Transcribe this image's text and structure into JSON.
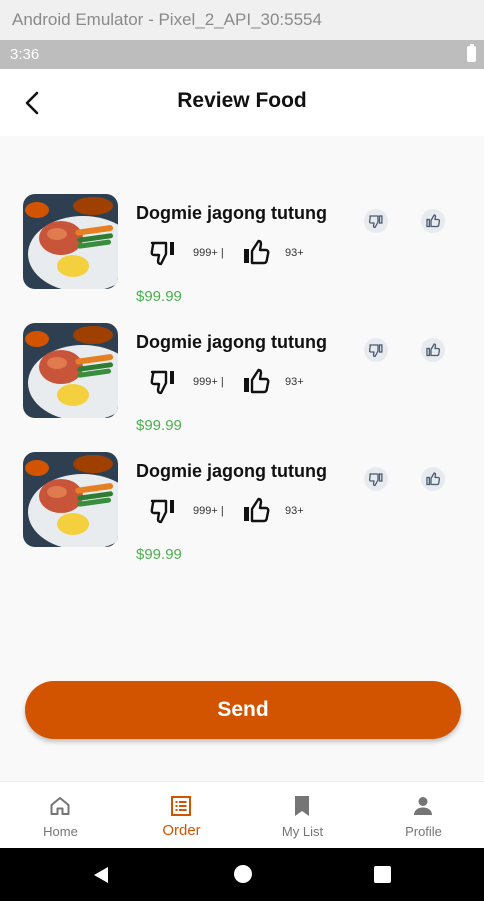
{
  "window": {
    "title": "Android Emulator - Pixel_2_API_30:5554"
  },
  "status_bar": {
    "time": "3:36"
  },
  "header": {
    "title": "Review Food",
    "back_icon": "arrow-back-icon"
  },
  "items": [
    {
      "name": "Dogmie jagong tutung",
      "dislike_count": "999+ |",
      "like_count": "93+",
      "price": "$99.99"
    },
    {
      "name": "Dogmie jagong tutung",
      "dislike_count": "999+ |",
      "like_count": "93+",
      "price": "$99.99"
    },
    {
      "name": "Dogmie jagong tutung",
      "dislike_count": "999+ |",
      "like_count": "93+",
      "price": "$99.99"
    }
  ],
  "send_button": {
    "label": "Send"
  },
  "bottom_nav": {
    "items": [
      {
        "label": "Home",
        "icon": "home-icon",
        "active": false
      },
      {
        "label": "Order",
        "icon": "order-list-icon",
        "active": true
      },
      {
        "label": "My List",
        "icon": "bookmark-icon",
        "active": false
      },
      {
        "label": "Profile",
        "icon": "person-icon",
        "active": false
      }
    ]
  },
  "colors": {
    "accent": "#d35400",
    "price": "#4caf50",
    "inactive": "#757575"
  }
}
